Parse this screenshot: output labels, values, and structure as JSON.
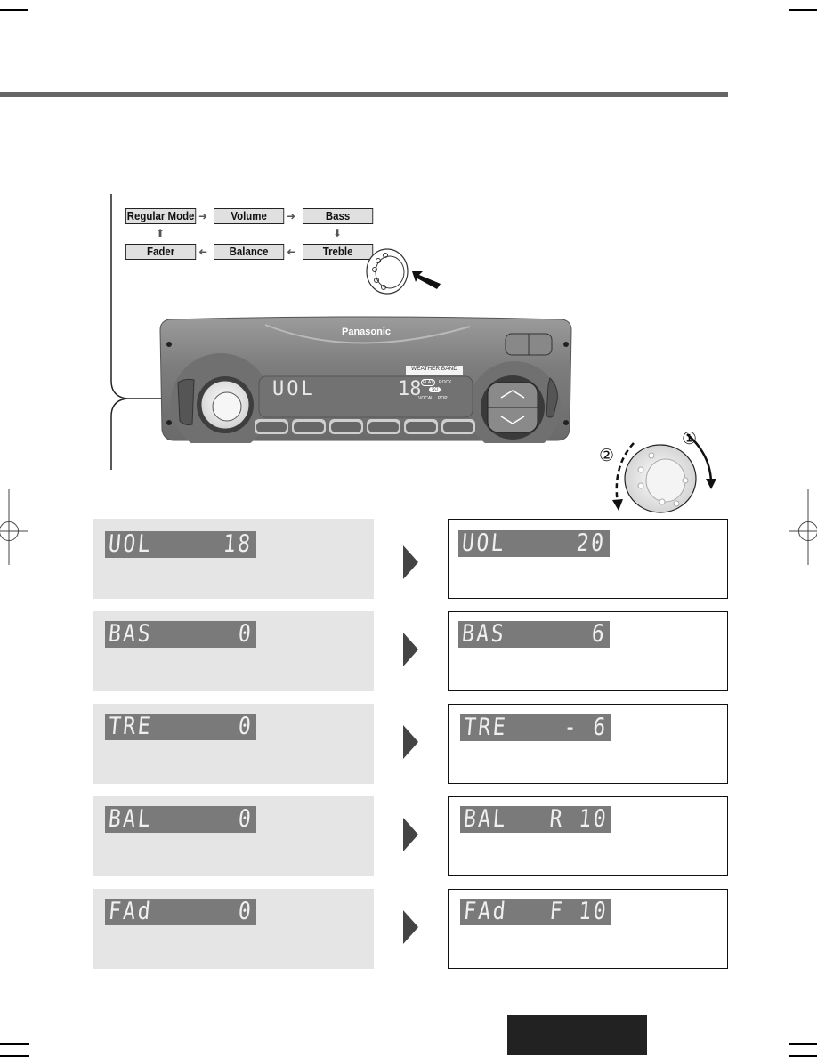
{
  "flow": {
    "regular_mode": "Regular Mode",
    "volume": "Volume",
    "bass": "Bass",
    "treble": "Treble",
    "balance": "Balance",
    "fader": "Fader"
  },
  "radio": {
    "brand": "Panasonic",
    "weather_band_label": "WEATHER BAND",
    "display_mode": "UOL",
    "display_value": "18",
    "eq_labels": [
      "FLAT",
      "ROCK",
      "VOCAL",
      "POP"
    ],
    "eq_center": "SQ"
  },
  "knob_direction": {
    "step_1": "①",
    "step_2": "②"
  },
  "settings": [
    {
      "name": "volume",
      "before_label": "UOL",
      "before_value": "18",
      "after_label": "UOL",
      "after_value": "20"
    },
    {
      "name": "bass",
      "before_label": "BAS",
      "before_value": "0",
      "after_label": "BAS",
      "after_value": "6"
    },
    {
      "name": "treble",
      "before_label": "TRE",
      "before_value": "0",
      "after_label": "TRE",
      "after_value": "- 6"
    },
    {
      "name": "balance",
      "before_label": "BAL",
      "before_value": "0",
      "after_label": "BAL",
      "after_value": "R 10"
    },
    {
      "name": "fader",
      "before_label": "FAd",
      "before_value": "0",
      "after_label": "FAd",
      "after_value": "F 10"
    }
  ],
  "colors": {
    "header_rule": "#666666",
    "lcd_bg": "#7a7a7a",
    "panel_bg": "#e5e5e5",
    "footer_tab": "#222222"
  }
}
